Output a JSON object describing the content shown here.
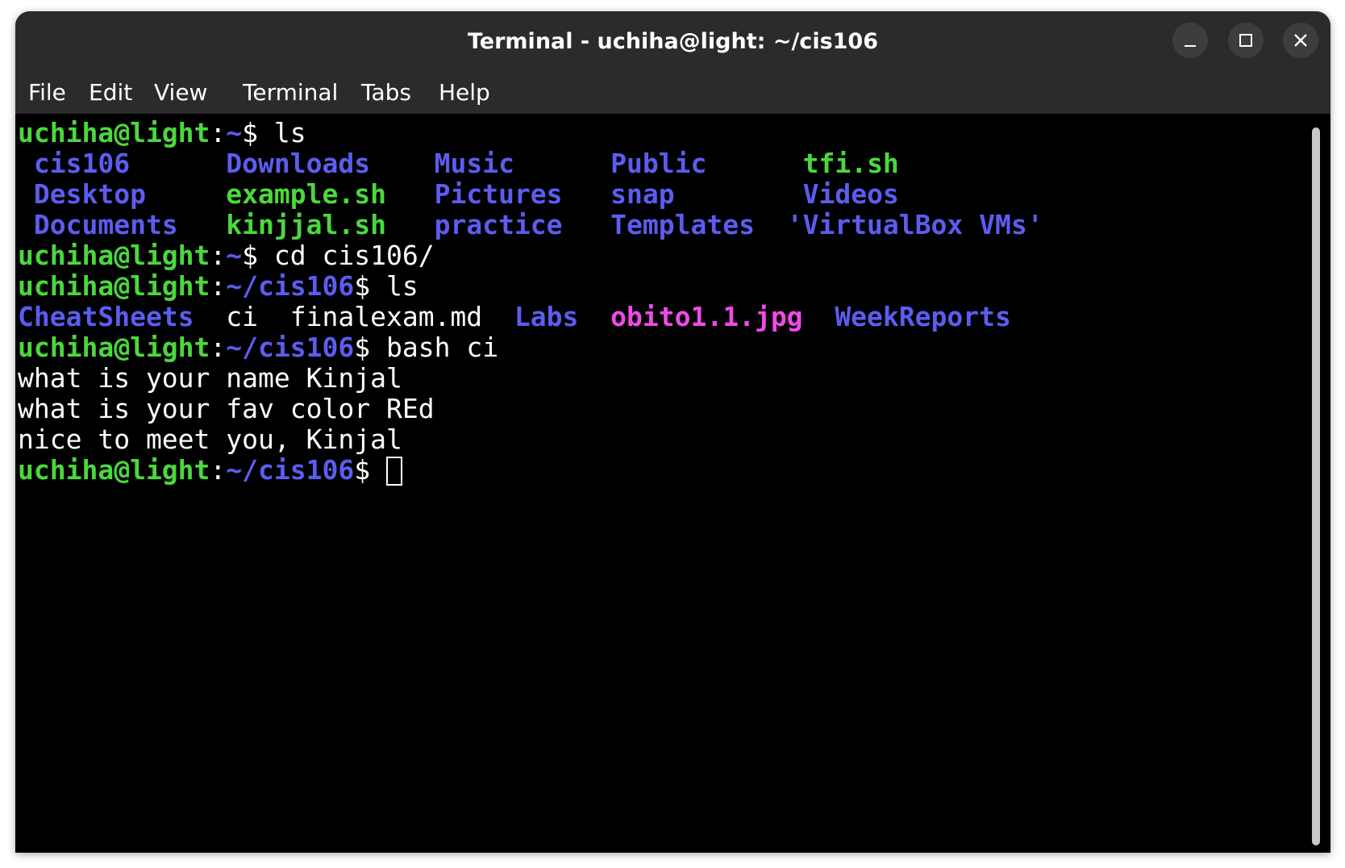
{
  "window": {
    "title": "Terminal - uchiha@light: ~/cis106"
  },
  "menu": [
    "File",
    "Edit",
    "View",
    "Terminal",
    "Tabs",
    "Help"
  ],
  "terminal": {
    "lines": [
      [
        {
          "text": "uchiha@light",
          "style": "g"
        },
        {
          "text": ":",
          "style": "w"
        },
        {
          "text": "~",
          "style": "b"
        },
        {
          "text": "$ ls",
          "style": "w"
        }
      ],
      [
        {
          "text": " cis106",
          "style": "b"
        },
        {
          "text": "      ",
          "style": "w"
        },
        {
          "text": "Downloads",
          "style": "b"
        },
        {
          "text": "    ",
          "style": "w"
        },
        {
          "text": "Music",
          "style": "b"
        },
        {
          "text": "      ",
          "style": "w"
        },
        {
          "text": "Public",
          "style": "b"
        },
        {
          "text": "      ",
          "style": "w"
        },
        {
          "text": "tfi.sh",
          "style": "g"
        }
      ],
      [
        {
          "text": " Desktop",
          "style": "b"
        },
        {
          "text": "     ",
          "style": "w"
        },
        {
          "text": "example.sh",
          "style": "g"
        },
        {
          "text": "   ",
          "style": "w"
        },
        {
          "text": "Pictures",
          "style": "b"
        },
        {
          "text": "   ",
          "style": "w"
        },
        {
          "text": "snap",
          "style": "b"
        },
        {
          "text": "        ",
          "style": "w"
        },
        {
          "text": "Videos",
          "style": "b"
        }
      ],
      [
        {
          "text": " Documents",
          "style": "b"
        },
        {
          "text": "   ",
          "style": "w"
        },
        {
          "text": "kinjjal.sh",
          "style": "g"
        },
        {
          "text": "   ",
          "style": "w"
        },
        {
          "text": "practice",
          "style": "b"
        },
        {
          "text": "   ",
          "style": "w"
        },
        {
          "text": "Templates",
          "style": "b"
        },
        {
          "text": "  ",
          "style": "w"
        },
        {
          "text": "'VirtualBox VMs'",
          "style": "b"
        }
      ],
      [
        {
          "text": "uchiha@light",
          "style": "g"
        },
        {
          "text": ":",
          "style": "w"
        },
        {
          "text": "~",
          "style": "b"
        },
        {
          "text": "$ cd cis106/",
          "style": "w"
        }
      ],
      [
        {
          "text": "uchiha@light",
          "style": "g"
        },
        {
          "text": ":",
          "style": "w"
        },
        {
          "text": "~/cis106",
          "style": "b"
        },
        {
          "text": "$ ls",
          "style": "w"
        }
      ],
      [
        {
          "text": "CheatSheets",
          "style": "b"
        },
        {
          "text": "  ci  finalexam.md  ",
          "style": "w"
        },
        {
          "text": "Labs",
          "style": "b"
        },
        {
          "text": "  ",
          "style": "w"
        },
        {
          "text": "obito1.1.jpg",
          "style": "m"
        },
        {
          "text": "  ",
          "style": "w"
        },
        {
          "text": "WeekReports",
          "style": "b"
        }
      ],
      [
        {
          "text": "uchiha@light",
          "style": "g"
        },
        {
          "text": ":",
          "style": "w"
        },
        {
          "text": "~/cis106",
          "style": "b"
        },
        {
          "text": "$ bash ci",
          "style": "w"
        }
      ],
      [
        {
          "text": "what is your name Kinjal",
          "style": "w"
        }
      ],
      [
        {
          "text": "what is your fav color REd",
          "style": "w"
        }
      ],
      [
        {
          "text": "nice to meet you, Kinjal",
          "style": "w"
        }
      ],
      [
        {
          "text": "uchiha@light",
          "style": "g"
        },
        {
          "text": ":",
          "style": "w"
        },
        {
          "text": "~/cis106",
          "style": "b"
        },
        {
          "text": "$ ",
          "style": "w"
        }
      ]
    ]
  },
  "colors": {
    "prompt_user": "#4bd83c",
    "directory": "#5c5cf0",
    "image_file": "#f049e8",
    "text": "#ffffff",
    "background": "#000000",
    "chrome": "#2b2b2b"
  }
}
